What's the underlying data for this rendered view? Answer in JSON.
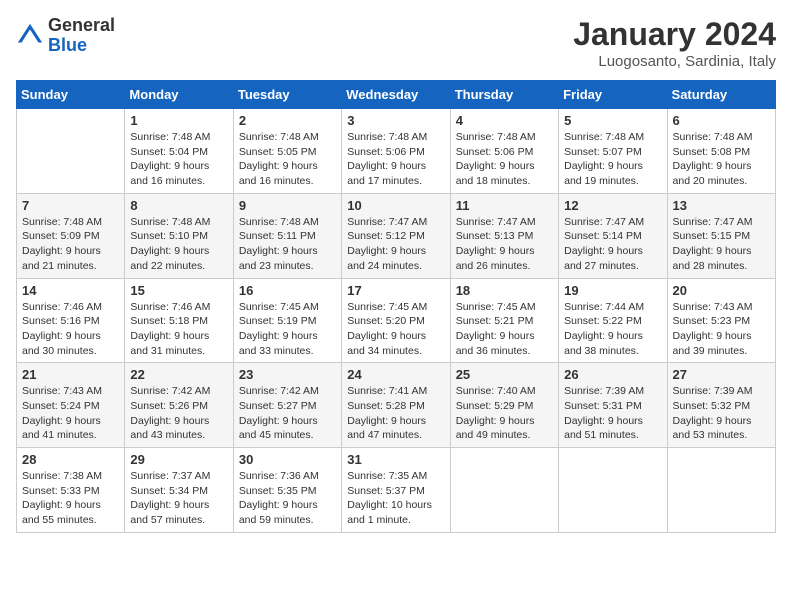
{
  "logo": {
    "general": "General",
    "blue": "Blue"
  },
  "header": {
    "month": "January 2024",
    "location": "Luogosanto, Sardinia, Italy"
  },
  "weekdays": [
    "Sunday",
    "Monday",
    "Tuesday",
    "Wednesday",
    "Thursday",
    "Friday",
    "Saturday"
  ],
  "weeks": [
    [
      {
        "day": "",
        "sunrise": "",
        "sunset": "",
        "daylight": ""
      },
      {
        "day": "1",
        "sunrise": "7:48 AM",
        "sunset": "5:04 PM",
        "daylight": "9 hours and 16 minutes."
      },
      {
        "day": "2",
        "sunrise": "7:48 AM",
        "sunset": "5:05 PM",
        "daylight": "9 hours and 16 minutes."
      },
      {
        "day": "3",
        "sunrise": "7:48 AM",
        "sunset": "5:06 PM",
        "daylight": "9 hours and 17 minutes."
      },
      {
        "day": "4",
        "sunrise": "7:48 AM",
        "sunset": "5:06 PM",
        "daylight": "9 hours and 18 minutes."
      },
      {
        "day": "5",
        "sunrise": "7:48 AM",
        "sunset": "5:07 PM",
        "daylight": "9 hours and 19 minutes."
      },
      {
        "day": "6",
        "sunrise": "7:48 AM",
        "sunset": "5:08 PM",
        "daylight": "9 hours and 20 minutes."
      }
    ],
    [
      {
        "day": "7",
        "sunrise": "7:48 AM",
        "sunset": "5:09 PM",
        "daylight": "9 hours and 21 minutes."
      },
      {
        "day": "8",
        "sunrise": "7:48 AM",
        "sunset": "5:10 PM",
        "daylight": "9 hours and 22 minutes."
      },
      {
        "day": "9",
        "sunrise": "7:48 AM",
        "sunset": "5:11 PM",
        "daylight": "9 hours and 23 minutes."
      },
      {
        "day": "10",
        "sunrise": "7:47 AM",
        "sunset": "5:12 PM",
        "daylight": "9 hours and 24 minutes."
      },
      {
        "day": "11",
        "sunrise": "7:47 AM",
        "sunset": "5:13 PM",
        "daylight": "9 hours and 26 minutes."
      },
      {
        "day": "12",
        "sunrise": "7:47 AM",
        "sunset": "5:14 PM",
        "daylight": "9 hours and 27 minutes."
      },
      {
        "day": "13",
        "sunrise": "7:47 AM",
        "sunset": "5:15 PM",
        "daylight": "9 hours and 28 minutes."
      }
    ],
    [
      {
        "day": "14",
        "sunrise": "7:46 AM",
        "sunset": "5:16 PM",
        "daylight": "9 hours and 30 minutes."
      },
      {
        "day": "15",
        "sunrise": "7:46 AM",
        "sunset": "5:18 PM",
        "daylight": "9 hours and 31 minutes."
      },
      {
        "day": "16",
        "sunrise": "7:45 AM",
        "sunset": "5:19 PM",
        "daylight": "9 hours and 33 minutes."
      },
      {
        "day": "17",
        "sunrise": "7:45 AM",
        "sunset": "5:20 PM",
        "daylight": "9 hours and 34 minutes."
      },
      {
        "day": "18",
        "sunrise": "7:45 AM",
        "sunset": "5:21 PM",
        "daylight": "9 hours and 36 minutes."
      },
      {
        "day": "19",
        "sunrise": "7:44 AM",
        "sunset": "5:22 PM",
        "daylight": "9 hours and 38 minutes."
      },
      {
        "day": "20",
        "sunrise": "7:43 AM",
        "sunset": "5:23 PM",
        "daylight": "9 hours and 39 minutes."
      }
    ],
    [
      {
        "day": "21",
        "sunrise": "7:43 AM",
        "sunset": "5:24 PM",
        "daylight": "9 hours and 41 minutes."
      },
      {
        "day": "22",
        "sunrise": "7:42 AM",
        "sunset": "5:26 PM",
        "daylight": "9 hours and 43 minutes."
      },
      {
        "day": "23",
        "sunrise": "7:42 AM",
        "sunset": "5:27 PM",
        "daylight": "9 hours and 45 minutes."
      },
      {
        "day": "24",
        "sunrise": "7:41 AM",
        "sunset": "5:28 PM",
        "daylight": "9 hours and 47 minutes."
      },
      {
        "day": "25",
        "sunrise": "7:40 AM",
        "sunset": "5:29 PM",
        "daylight": "9 hours and 49 minutes."
      },
      {
        "day": "26",
        "sunrise": "7:39 AM",
        "sunset": "5:31 PM",
        "daylight": "9 hours and 51 minutes."
      },
      {
        "day": "27",
        "sunrise": "7:39 AM",
        "sunset": "5:32 PM",
        "daylight": "9 hours and 53 minutes."
      }
    ],
    [
      {
        "day": "28",
        "sunrise": "7:38 AM",
        "sunset": "5:33 PM",
        "daylight": "9 hours and 55 minutes."
      },
      {
        "day": "29",
        "sunrise": "7:37 AM",
        "sunset": "5:34 PM",
        "daylight": "9 hours and 57 minutes."
      },
      {
        "day": "30",
        "sunrise": "7:36 AM",
        "sunset": "5:35 PM",
        "daylight": "9 hours and 59 minutes."
      },
      {
        "day": "31",
        "sunrise": "7:35 AM",
        "sunset": "5:37 PM",
        "daylight": "10 hours and 1 minute."
      },
      {
        "day": "",
        "sunrise": "",
        "sunset": "",
        "daylight": ""
      },
      {
        "day": "",
        "sunrise": "",
        "sunset": "",
        "daylight": ""
      },
      {
        "day": "",
        "sunrise": "",
        "sunset": "",
        "daylight": ""
      }
    ]
  ]
}
